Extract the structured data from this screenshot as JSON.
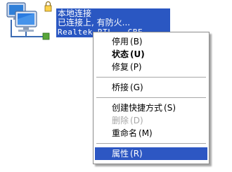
{
  "connection": {
    "name": "本地连接",
    "status": "已连接上, 有防火...",
    "adapter": "Realtek RTL...GBE"
  },
  "menu": {
    "items": [
      {
        "label": "停用",
        "accel": "(B)",
        "bold": false,
        "disabled": false,
        "selected": false
      },
      {
        "label": "状态",
        "accel": "(U)",
        "bold": true,
        "disabled": false,
        "selected": false
      },
      {
        "label": "修复",
        "accel": "(P)",
        "bold": false,
        "disabled": false,
        "selected": false
      },
      {
        "label": "桥接",
        "accel": "(G)",
        "bold": false,
        "disabled": false,
        "selected": false
      },
      {
        "label": "创建快捷方式",
        "accel": "(S)",
        "bold": false,
        "disabled": false,
        "selected": false
      },
      {
        "label": "删除",
        "accel": "(D)",
        "bold": false,
        "disabled": true,
        "selected": false
      },
      {
        "label": "重命名",
        "accel": "(M)",
        "bold": false,
        "disabled": false,
        "selected": false
      },
      {
        "label": "属性",
        "accel": "(R)",
        "bold": false,
        "disabled": false,
        "selected": true
      }
    ]
  },
  "colors": {
    "selection": "#2d57c3",
    "menu_border": "#8c8c8c",
    "disabled_text": "#a7a7a7"
  },
  "icons": [
    "network-connection-icon",
    "lock-icon"
  ]
}
